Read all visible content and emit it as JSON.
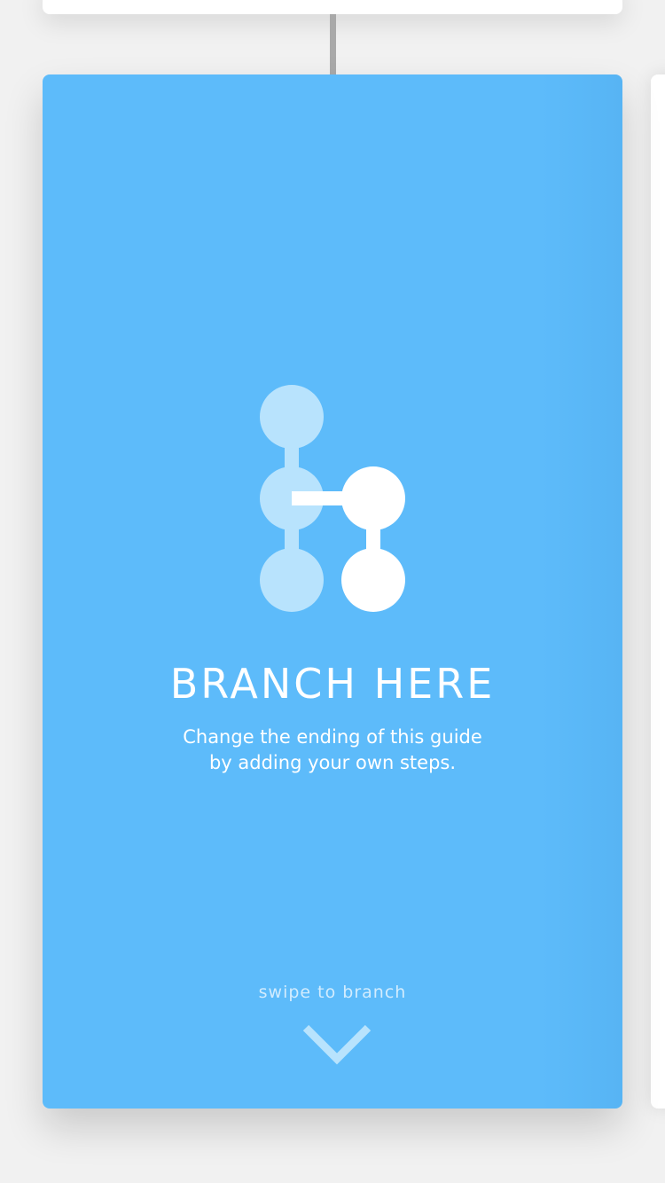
{
  "branch_card": {
    "title": "BRANCH HERE",
    "description_line1": "Change the ending of this guide",
    "description_line2": "by adding your own steps.",
    "swipe_hint": "swipe to branch",
    "icon": "branch-icon",
    "swipe_icon": "chevron-down-icon"
  },
  "colors": {
    "card_background": "#5dbbfa",
    "icon_light": "#b8e3fd",
    "icon_white": "#ffffff",
    "page_background": "#f1f1f1",
    "connector": "#a9a9a9"
  }
}
